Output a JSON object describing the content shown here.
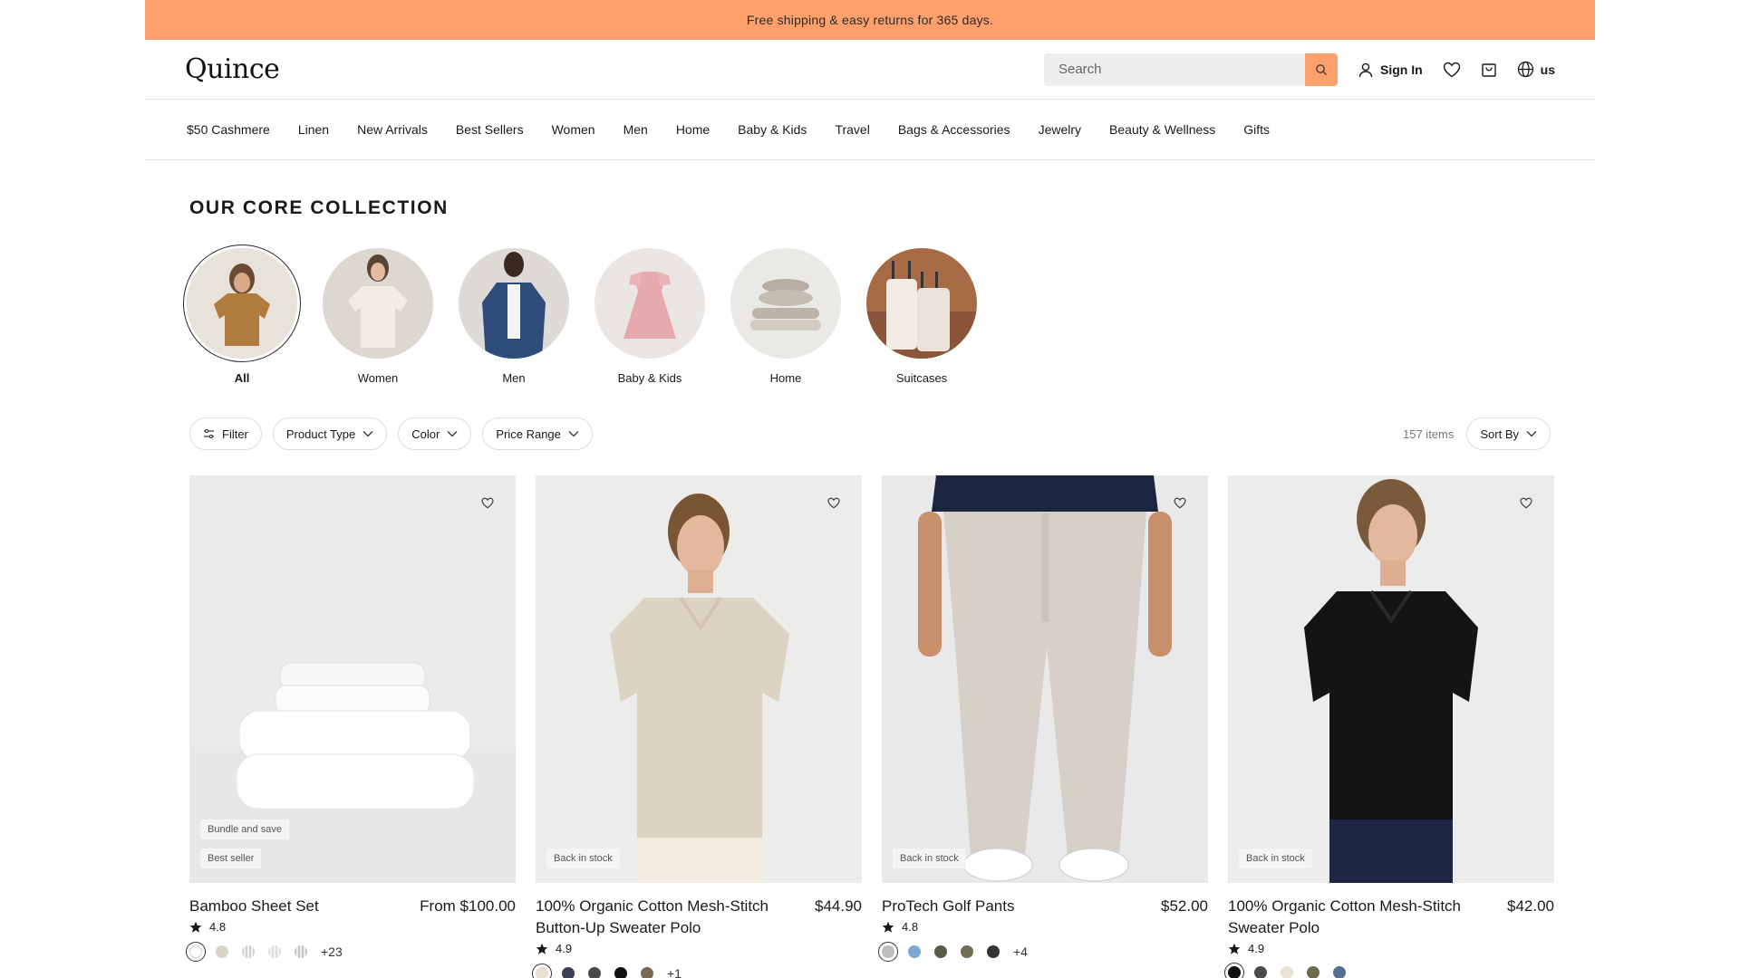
{
  "promo": {
    "text": "Free shipping & easy returns for 365 days."
  },
  "header": {
    "logo": "Quince",
    "search_placeholder": "Search",
    "sign_in": "Sign In",
    "region": "us"
  },
  "nav": {
    "items": [
      "$50 Cashmere",
      "Linen",
      "New Arrivals",
      "Best Sellers",
      "Women",
      "Men",
      "Home",
      "Baby & Kids",
      "Travel",
      "Bags & Accessories",
      "Jewelry",
      "Beauty & Wellness",
      "Gifts"
    ]
  },
  "collection": {
    "title": "OUR CORE COLLECTION",
    "categories": [
      {
        "label": "All"
      },
      {
        "label": "Women"
      },
      {
        "label": "Men"
      },
      {
        "label": "Baby & Kids"
      },
      {
        "label": "Home"
      },
      {
        "label": "Suitcases"
      }
    ]
  },
  "filters": {
    "filter_label": "Filter",
    "product_type": "Product Type",
    "color": "Color",
    "price_range": "Price Range",
    "items_count": "157 items",
    "sort_by": "Sort By"
  },
  "products": [
    {
      "name": "Bamboo Sheet Set",
      "price": "From $100.00",
      "rating": "4.8",
      "badges": [
        "Bundle and save",
        "Best seller"
      ],
      "swatches": [
        "#ffffff",
        "#d9d4c6",
        "#bfbfbf",
        "#e6e6e6",
        "#d0d0d0"
      ],
      "more": "+23"
    },
    {
      "name": "100% Organic Cotton Mesh-Stitch Button-Up Sweater Polo",
      "price": "$44.90",
      "rating": "4.9",
      "badges": [
        "Back in stock"
      ],
      "swatches": [
        "#e7dfcf",
        "#3b4056",
        "#4a4a4a",
        "#111111",
        "#7a6a55"
      ],
      "more": "+1"
    },
    {
      "name": "ProTech Golf Pants",
      "price": "$52.00",
      "rating": "4.8",
      "badges": [
        "Back in stock"
      ],
      "swatches": [
        "#bdbdbd",
        "#7fa7d2",
        "#5a5a45",
        "#6e6e55",
        "#333333"
      ],
      "more": "+4"
    },
    {
      "name": "100% Organic Cotton Mesh-Stitch Sweater Polo",
      "price": "$42.00",
      "rating": "4.9",
      "badges": [
        "Back in stock"
      ],
      "swatches": [
        "#111111",
        "#4a4a4a",
        "#e9e3d6",
        "#6b6a4d",
        "#5a6f95"
      ],
      "more": ""
    }
  ]
}
